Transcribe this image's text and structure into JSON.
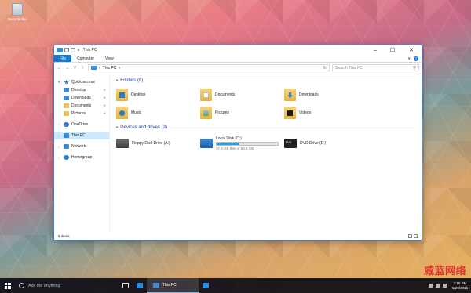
{
  "desktop": {
    "recycle_bin_label": "Recycle Bin"
  },
  "window": {
    "title": "This PC",
    "quick_access_dropdown": "∨",
    "ribbon_tabs": [
      "File",
      "Computer",
      "View"
    ],
    "help_label": "?",
    "address": {
      "path": "This PC",
      "separator": "›",
      "search_placeholder": "Search This PC"
    },
    "sidebar": {
      "quick_access": "Quick access",
      "quick_items": [
        "Desktop",
        "Downloads",
        "Documents",
        "Pictures"
      ],
      "onedrive": "OneDrive",
      "this_pc": "This PC",
      "network": "Network",
      "homegroup": "Homegroup"
    },
    "folders_header": "Folders (6)",
    "folders": [
      "Desktop",
      "Documents",
      "Downloads",
      "Music",
      "Pictures",
      "Videos"
    ],
    "drives_header": "Devices and drives (3)",
    "drives": {
      "floppy": "Floppy Disk Drive (A:)",
      "local": "Local Disk (C:)",
      "local_free": "37.5 GB free of 59.8 GB",
      "local_used_fraction": 0.373,
      "dvd": "DVD Drive (D:)"
    },
    "status": "9 items"
  },
  "taskbar": {
    "search_placeholder": "Ask me anything",
    "app_label": "This PC",
    "time": "7:16 PM",
    "date": "5/29/2015"
  },
  "watermark": "威蓝网络",
  "colors": {
    "accent": "#1979ca",
    "selection": "#cce8ff",
    "capacity_fill": "#26a0da"
  }
}
